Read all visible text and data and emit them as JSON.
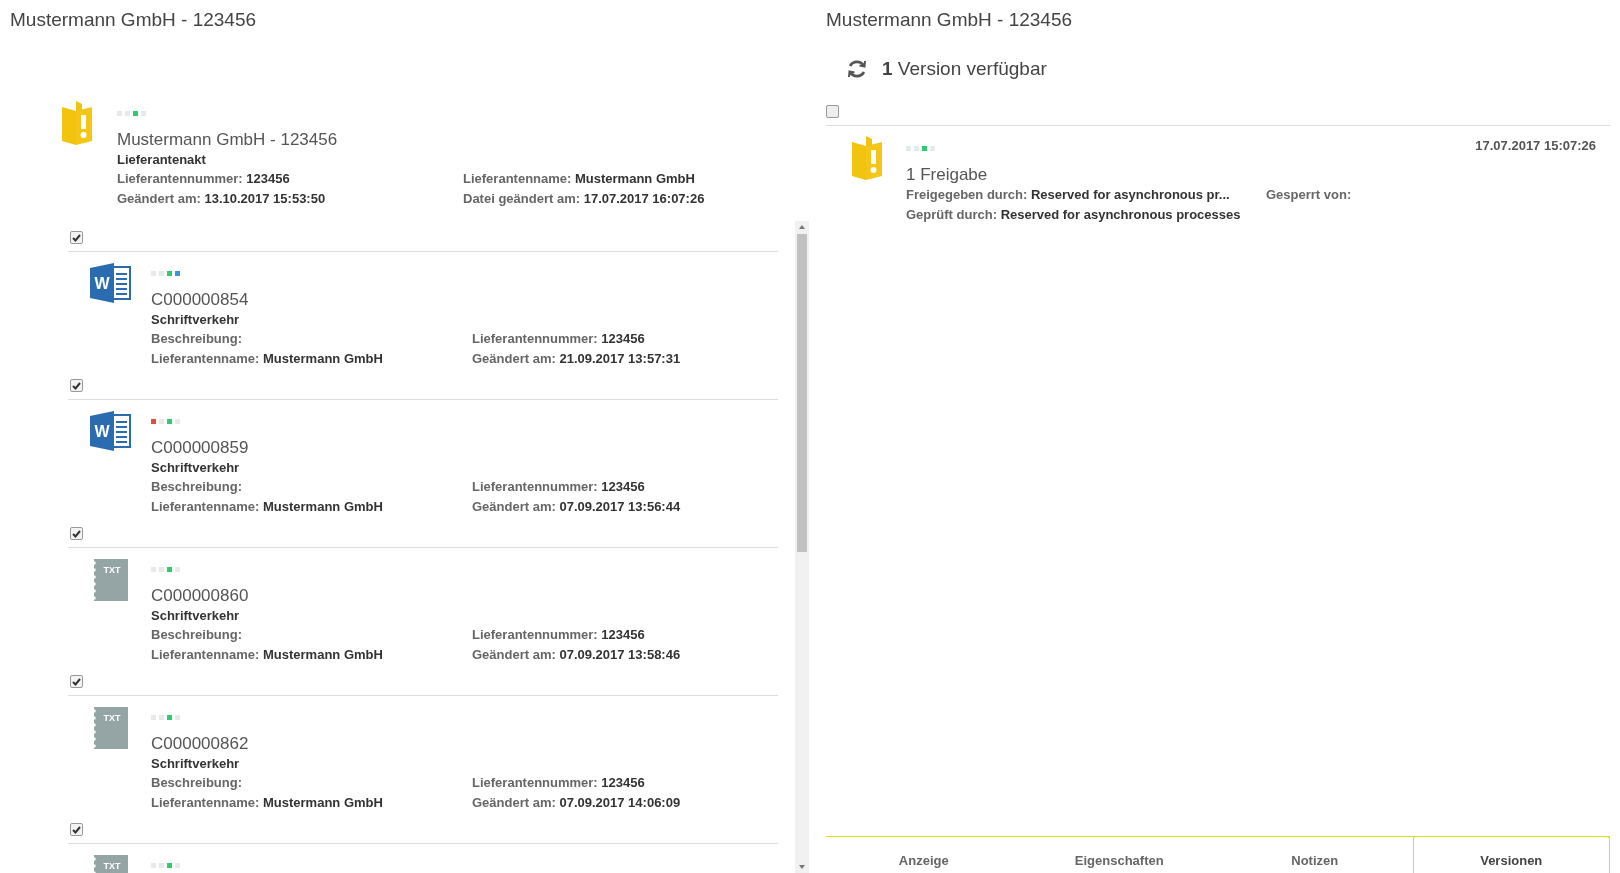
{
  "left_panel": {
    "title": "Mustermann GmbH - 123456",
    "record": {
      "kind": "folder",
      "status": [
        {
          "color": "#e6eaea"
        },
        {
          "color": "#e6eaea"
        },
        {
          "color": "#2ecc71"
        },
        {
          "color": "#e6eaea"
        }
      ],
      "title": "Mustermann GmbH - 123456",
      "type": "Lieferantenakt",
      "fields": [
        {
          "label": "Lieferantennummer:",
          "value": "123456"
        },
        {
          "label": "Lieferantenname:",
          "value": "Mustermann GmbH"
        },
        {
          "label": "Geändert am:",
          "value": "13.10.2017 15:53:50"
        },
        {
          "label": "Datei geändert am:",
          "value": "17.07.2017 16:07:26"
        }
      ]
    },
    "documents": [
      {
        "checked": true,
        "kind": "word",
        "icon_label": "W",
        "status": [
          {
            "color": "#e6eaea"
          },
          {
            "color": "#e6eaea"
          },
          {
            "color": "#2ecc71"
          },
          {
            "color": "#3498db"
          }
        ],
        "number": "C000000854",
        "type": "Schriftverkehr",
        "fields": [
          {
            "label": "Beschreibung:"
          },
          {
            "label": "Lieferantennummer:",
            "value": "123456"
          },
          {
            "label": "Lieferantenname:",
            "value": "Mustermann GmbH"
          },
          {
            "label": "Geändert am:",
            "value": "21.09.2017 13:57:31"
          }
        ]
      },
      {
        "checked": true,
        "kind": "word",
        "icon_label": "W",
        "status": [
          {
            "color": "#e74c3c"
          },
          {
            "color": "#e6eaea"
          },
          {
            "color": "#2ecc71"
          },
          {
            "color": "#e6eaea"
          }
        ],
        "number": "C000000859",
        "type": "Schriftverkehr",
        "fields": [
          {
            "label": "Beschreibung:"
          },
          {
            "label": "Lieferantennummer:",
            "value": "123456"
          },
          {
            "label": "Lieferantenname:",
            "value": "Mustermann GmbH"
          },
          {
            "label": "Geändert am:",
            "value": "07.09.2017 13:56:44"
          }
        ]
      },
      {
        "checked": true,
        "kind": "txt",
        "icon_label": "TXT",
        "status": [
          {
            "color": "#e6eaea"
          },
          {
            "color": "#e6eaea"
          },
          {
            "color": "#2ecc71"
          },
          {
            "color": "#e6eaea"
          }
        ],
        "number": "C000000860",
        "type": "Schriftverkehr",
        "fields": [
          {
            "label": "Beschreibung:"
          },
          {
            "label": "Lieferantennummer:",
            "value": "123456"
          },
          {
            "label": "Lieferantenname:",
            "value": "Mustermann GmbH"
          },
          {
            "label": "Geändert am:",
            "value": "07.09.2017 13:58:46"
          }
        ]
      },
      {
        "checked": true,
        "kind": "txt",
        "icon_label": "TXT",
        "status": [
          {
            "color": "#e6eaea"
          },
          {
            "color": "#e6eaea"
          },
          {
            "color": "#2ecc71"
          },
          {
            "color": "#e6eaea"
          }
        ],
        "number": "C000000862",
        "type": "Schriftverkehr",
        "fields": [
          {
            "label": "Beschreibung:"
          },
          {
            "label": "Lieferantennummer:",
            "value": "123456"
          },
          {
            "label": "Lieferantenname:",
            "value": "Mustermann GmbH"
          },
          {
            "label": "Geändert am:",
            "value": "07.09.2017 14:06:09"
          }
        ]
      },
      {
        "checked": true,
        "kind": "txt",
        "icon_label": "TXT",
        "status": [
          {
            "color": "#e6eaea"
          },
          {
            "color": "#e6eaea"
          },
          {
            "color": "#2ecc71"
          },
          {
            "color": "#e6eaea"
          }
        ]
      }
    ]
  },
  "right_panel": {
    "title": "Mustermann GmbH - 123456",
    "versions_heading": "**1** Version verfügbar",
    "select_all_checked": false,
    "versions": [
      {
        "kind": "folder",
        "status": [
          {
            "color": "#e6eaea"
          },
          {
            "color": "#e6eaea"
          },
          {
            "color": "#2ecc71"
          },
          {
            "color": "#e6eaea"
          }
        ],
        "title": "1 Freigabe",
        "date": "17.07.2017 15:07:26",
        "fields": [
          {
            "label": "Freigegeben durch:",
            "value": "Reserved for asynchronous pr..."
          },
          {
            "label": "Gesperrt von:"
          },
          {
            "label": "Geprüft durch:",
            "value": "Reserved for asynchronous processes"
          }
        ]
      }
    ],
    "tabs": [
      {
        "label": "Anzeige",
        "selected": false
      },
      {
        "label": "Eigenschaften",
        "selected": false
      },
      {
        "label": "Notizen",
        "selected": false
      },
      {
        "label": "Versionen",
        "selected": true
      }
    ]
  }
}
